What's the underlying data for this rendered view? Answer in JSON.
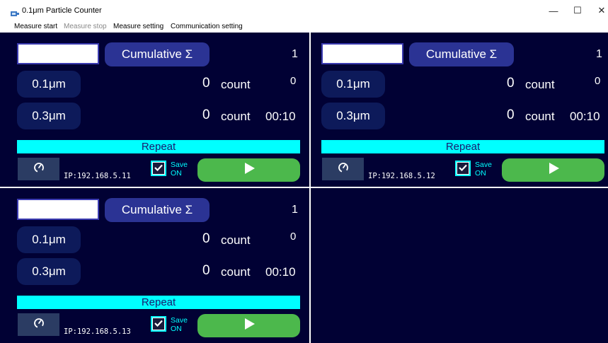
{
  "window": {
    "title": "0.1μm Particle Counter",
    "minimize": "—",
    "maximize": "☐",
    "close": "✕"
  },
  "menu": [
    {
      "label": "Measure start",
      "disabled": false
    },
    {
      "label": "Measure stop",
      "disabled": true
    },
    {
      "label": "Measure setting",
      "disabled": false
    },
    {
      "label": "Communication setting",
      "disabled": false
    }
  ],
  "panels": [
    {
      "input_value": "",
      "cumulative_label": "Cumulative Σ",
      "index": "1",
      "rows": [
        {
          "size": "0.1μm",
          "value": "0",
          "unit": "count",
          "extra": "0"
        },
        {
          "size": "0.3μm",
          "value": "0",
          "unit": "count",
          "extra": "00:10"
        }
      ],
      "repeat_label": "Repeat",
      "ip": "IP:192.168.5.11",
      "save_line1": "Save",
      "save_line2": "ON",
      "save_checked": true
    },
    {
      "input_value": "",
      "cumulative_label": "Cumulative Σ",
      "index": "1",
      "rows": [
        {
          "size": "0.1μm",
          "value": "0",
          "unit": "count",
          "extra": "0"
        },
        {
          "size": "0.3μm",
          "value": "0",
          "unit": "count",
          "extra": "00:10"
        }
      ],
      "repeat_label": "Repeat",
      "ip": "IP:192.168.5.12",
      "save_line1": "Save",
      "save_line2": "ON",
      "save_checked": true
    },
    {
      "input_value": "",
      "cumulative_label": "Cumulative Σ",
      "index": "1",
      "rows": [
        {
          "size": "0.1μm",
          "value": "0",
          "unit": "count",
          "extra": "0"
        },
        {
          "size": "0.3μm",
          "value": "0",
          "unit": "count",
          "extra": "00:10"
        }
      ],
      "repeat_label": "Repeat",
      "ip": "IP:192.168.5.13",
      "save_line1": "Save",
      "save_line2": "ON",
      "save_checked": true
    }
  ],
  "colors": {
    "panel_bg": "#010134",
    "accent_cyan": "#00ffff",
    "button_blue": "#2b3394",
    "play_green": "#4cb84c"
  }
}
